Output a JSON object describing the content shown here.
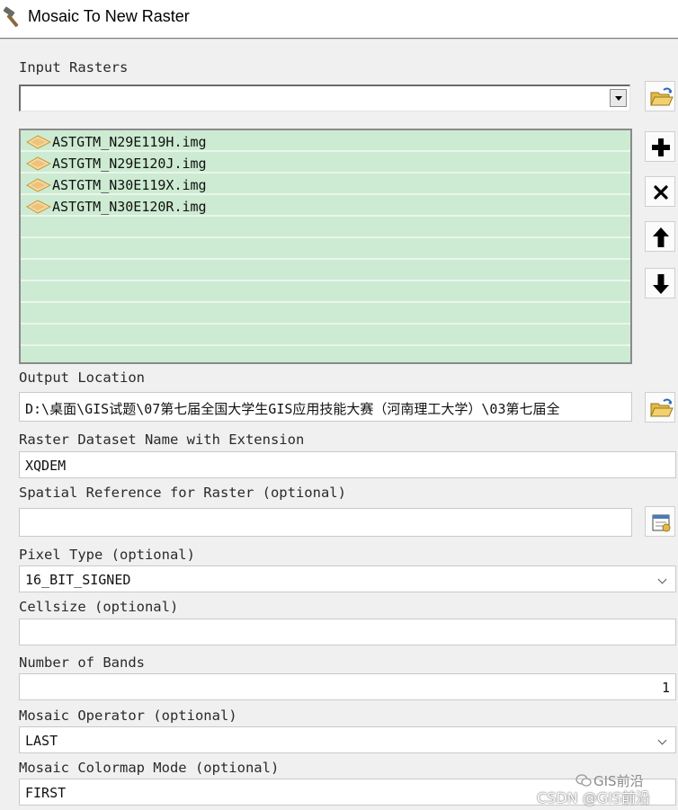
{
  "window": {
    "title": "Mosaic To New Raster",
    "icon": "hammer-icon"
  },
  "input_rasters": {
    "label": "Input Rasters",
    "combo_value": "",
    "items": [
      "ASTGTM_N29E119H.img",
      "ASTGTM_N29E120J.img",
      "ASTGTM_N30E119X.img",
      "ASTGTM_N30E120R.img"
    ],
    "buttons": {
      "browse": "open-folder-icon",
      "add": "plus-icon",
      "remove": "close-icon",
      "up": "arrow-up-icon",
      "down": "arrow-down-icon"
    }
  },
  "output_location": {
    "label": "Output Location",
    "value": "D:\\桌面\\GIS试题\\07第七届全国大学生GIS应用技能大赛（河南理工大学）\\03第七届全"
  },
  "raster_name": {
    "label": "Raster Dataset Name with Extension",
    "value": "XQDEM"
  },
  "spatial_reference": {
    "label": "Spatial Reference for Raster (optional)",
    "value": ""
  },
  "pixel_type": {
    "label": "Pixel Type (optional)",
    "value": "16_BIT_SIGNED"
  },
  "cellsize": {
    "label": "Cellsize (optional)",
    "value": ""
  },
  "bands": {
    "label": "Number of Bands",
    "value": "1"
  },
  "mosaic_operator": {
    "label": "Mosaic Operator (optional)",
    "value": "LAST"
  },
  "colormap_mode": {
    "label": "Mosaic Colormap Mode (optional)",
    "value": "FIRST"
  },
  "watermark": {
    "line1": "GIS前沿",
    "line2": "CSDN @GIS前沿"
  },
  "colors": {
    "list_bg": "#cdebd2",
    "title_bg": "#ffffff",
    "window_bg": "#f0f0f0"
  }
}
